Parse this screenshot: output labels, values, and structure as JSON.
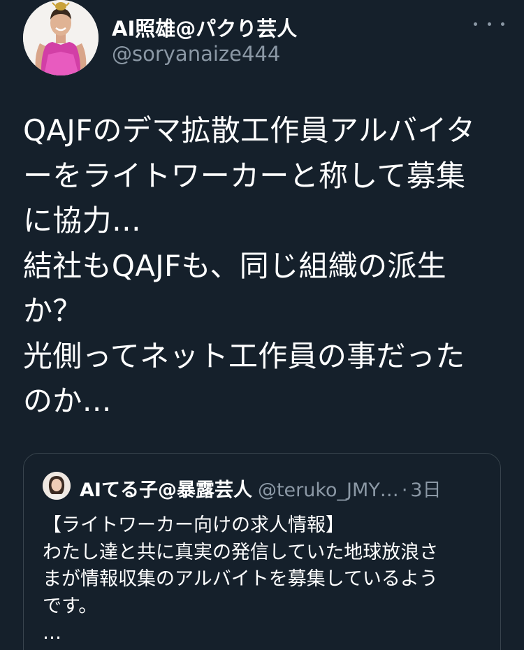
{
  "author": {
    "display_name": "AI照雄@パクり芸人",
    "handle": "@soryanaize444",
    "avatar_icon": "person-avatar-icon"
  },
  "more_icon": "more-options-icon",
  "tweet": {
    "lines": [
      "QAJFのデマ拡散工作員アルバイタ",
      "ーをライトワーカーと称して募集",
      "に協力…",
      "結社もQAJFも、同じ組織の派生",
      "か？",
      "光側ってネット工作員の事だった",
      "のか…"
    ]
  },
  "quoted_tweet": {
    "display_name": "AIてる子@暴露芸人",
    "handle": "@teruko_JMY…",
    "separator": "·",
    "time": "3日",
    "lines": [
      "【ライトワーカー向けの求人情報】",
      "わたし達と共に真実の発信していた地球放浪さ",
      "まが情報収集のアルバイトを募集しているよう",
      "です。",
      "…"
    ]
  },
  "colors": {
    "background": "#15202b",
    "text": "#ffffff",
    "secondary_text": "#8b98a5",
    "border": "#38444d"
  }
}
